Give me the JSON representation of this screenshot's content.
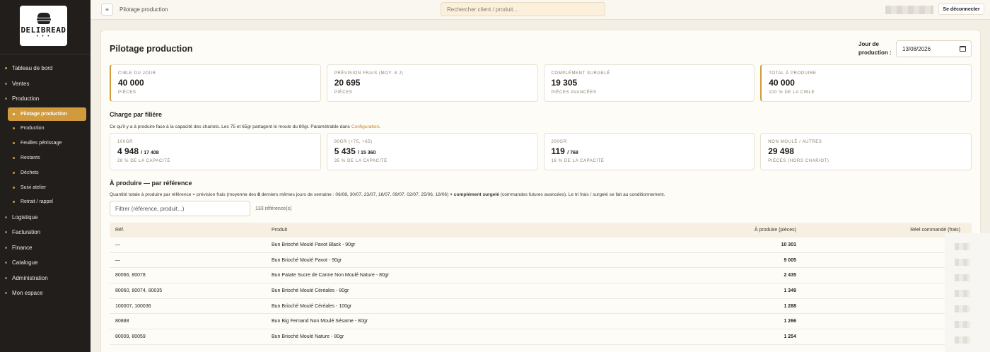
{
  "brand": {
    "name": "DELIBREAD",
    "dots": "• • •"
  },
  "sidebar": {
    "items": [
      {
        "label": "Tableau de bord"
      },
      {
        "label": "Ventes"
      },
      {
        "label": "Production"
      },
      {
        "label": "Pilotage production"
      },
      {
        "label": "Production"
      },
      {
        "label": "Feuilles pétrissage"
      },
      {
        "label": "Restants"
      },
      {
        "label": "Déchets"
      },
      {
        "label": "Suivi atelier"
      },
      {
        "label": "Retrait / rappel"
      },
      {
        "label": "Logistique"
      },
      {
        "label": "Facturation"
      },
      {
        "label": "Finance"
      },
      {
        "label": "Catalogue"
      },
      {
        "label": "Administration"
      },
      {
        "label": "Mon espace"
      }
    ]
  },
  "topbar": {
    "menu_icon": "≡",
    "title": "Pilotage production",
    "search_placeholder": "Rechercher client / produit...",
    "logout_label": "Se déconnecter"
  },
  "page": {
    "title": "Pilotage production",
    "date_label": "Jour de production :",
    "date_value": "13/08/2026"
  },
  "kpis": [
    {
      "label": "CIBLE DU JOUR",
      "value": "40 000",
      "sub": "PIÈCES"
    },
    {
      "label": "PRÉVISION FRAIS (MOY. 8 J)",
      "value": "20 695",
      "sub": "PIÈCES"
    },
    {
      "label": "COMPLÉMENT SURGELÉ",
      "value": "19 305",
      "sub": "PIÈCES AVANCÉES"
    },
    {
      "label": "TOTAL À PRODUIRE",
      "value": "40 000",
      "sub": "100 % DE LA CIBLE"
    }
  ],
  "charge": {
    "title": "Charge par filière",
    "desc_pre": "Ce qu'il y a à produire face à la capacité des chariots. Les 75 et 65gr partagent le moule du 80gr. Paramétrable dans ",
    "desc_link": "Configuration",
    "desc_post": ".",
    "cards": [
      {
        "label": "100GR",
        "value": "4 948",
        "capacity": "/ 17 408",
        "sub": "28 % DE LA CAPACITÉ"
      },
      {
        "label": "80GR (+75, +65)",
        "value": "5 435",
        "capacity": "/ 15 360",
        "sub": "35 % DE LA CAPACITÉ"
      },
      {
        "label": "200GR",
        "value": "119",
        "capacity": "/ 768",
        "sub": "16 % DE LA CAPACITÉ"
      },
      {
        "label": "NON MOULÉ / AUTRES",
        "value": "29 498",
        "capacity": "",
        "sub": "PIÈCES (HORS CHARIOT)"
      }
    ]
  },
  "refs": {
    "title": "À produire — par référence",
    "desc_1": "Quantité totale à produire par référence = prévision frais (moyenne des ",
    "desc_n": "8",
    "desc_2": " derniers mêmes jours de semaine : 06/08, 30/07, 23/07, 16/07, 09/07, 02/07, 25/06, 18/06) ",
    "desc_bold": "+ complément surgelé",
    "desc_3": " (commandes futures avancées). Le tri frais / surgelé se fait au conditionnement.",
    "filter_placeholder": "Filtrer (référence, produit...)",
    "count": "133 référence(s)",
    "columns": {
      "ref": "Réf.",
      "product": "Produit",
      "qty": "À produire (pièces)",
      "reel": "Réel commandé (frais)"
    },
    "rows": [
      {
        "ref": "—",
        "product": "Bun Brioché Moulé Pavot Black - 90gr",
        "qty": "10 301"
      },
      {
        "ref": "—",
        "product": "Bun Brioché Moulé Pavot - 90gr",
        "qty": "9 005"
      },
      {
        "ref": "80066, 80078",
        "product": "Bun Patate Sucre de Canne Non Moulé Nature - 80gr",
        "qty": "2 435"
      },
      {
        "ref": "80060, 80074, 80035",
        "product": "Bun Brioché Moulé Céréales - 80gr",
        "qty": "1 349"
      },
      {
        "ref": "100007, 100036",
        "product": "Bun Brioché Moulé Céréales - 100gr",
        "qty": "1 288"
      },
      {
        "ref": "80888",
        "product": "Bun Big Fernand Non Moulé Sésame - 80gr",
        "qty": "1 266"
      },
      {
        "ref": "80009, 80059",
        "product": "Bun Brioché Moulé Nature - 80gr",
        "qty": "1 254"
      }
    ]
  },
  "colors": {
    "accent": "#d19a3c",
    "sidebar_bg": "#221e1b",
    "page_bg": "#f3efe5"
  }
}
